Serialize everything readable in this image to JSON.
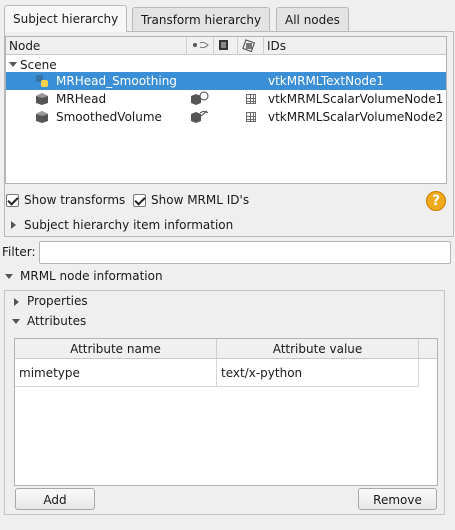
{
  "tabs": [
    "Subject hierarchy",
    "Transform hierarchy",
    "All nodes"
  ],
  "tree": {
    "headers": {
      "node": "Node",
      "ids": "IDs"
    },
    "scene_label": "Scene",
    "rows": [
      {
        "name": "MRHead_Smoothing",
        "id": "vtkMRMLTextNode1",
        "icon": "python-icon",
        "selected": true
      },
      {
        "name": "MRHead",
        "id": "vtkMRMLScalarVolumeNode1",
        "icon": "volume-icon",
        "selected": false
      },
      {
        "name": "SmoothedVolume",
        "id": "vtkMRMLScalarVolumeNode2",
        "icon": "volume-icon",
        "selected": false
      }
    ]
  },
  "options": {
    "show_transforms": "Show transforms",
    "show_mrml_ids": "Show MRML ID's",
    "help": "?"
  },
  "item_info_label": "Subject hierarchy item information",
  "filter": {
    "label": "Filter:",
    "value": ""
  },
  "mrml_section": "MRML node information",
  "properties_label": "Properties",
  "attributes_label": "Attributes",
  "attributes": {
    "col_name": "Attribute name",
    "col_value": "Attribute value",
    "rows": [
      {
        "name": "mimetype",
        "value": "text/x-python"
      }
    ]
  },
  "buttons": {
    "add": "Add",
    "remove": "Remove"
  },
  "colors": {
    "selection": "#3b8fd6",
    "help": "#f0a81c"
  }
}
